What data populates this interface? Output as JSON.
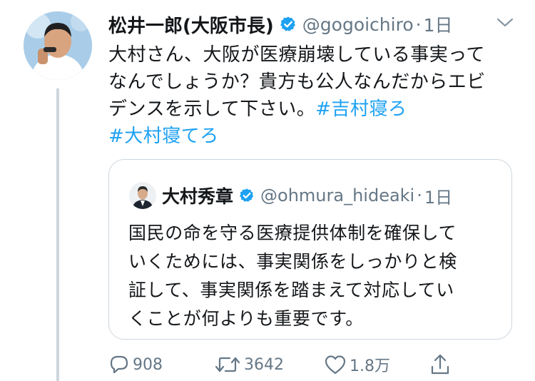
{
  "tweet": {
    "author_name": "松井一郎(大阪市長)",
    "handle": "@gogoichiro",
    "separator": "·",
    "time": "1日",
    "text_lines": [
      "大村さん、大阪が医療崩壊している事実って",
      "なんでしょうか？貴方も公人なんだからエビ"
    ],
    "text_line3": "デンスを示して下さい。",
    "hashtag1": "#吉村寝ろ",
    "hashtag2": "#大村寝てろ"
  },
  "quoted_tweet": {
    "author_name": "大村秀章",
    "handle": "@ohmura_hideaki",
    "separator": "·",
    "time": "1日",
    "text_lines": [
      "国民の命を守る医療提供体制を確保して",
      "いくためには、事実関係をしっかりと検",
      "証して、事実関係を踏まえて対応してい",
      "くことが何よりも重要です。"
    ]
  },
  "actions": {
    "reply_count": "908",
    "retweet_count": "3642",
    "like_count": "1.8万"
  },
  "colors": {
    "accent": "#1da1f2",
    "secondary_text": "#657786",
    "border": "#ccd6dd"
  },
  "icons": [
    "verified-badge-icon",
    "chevron-down-icon",
    "reply-icon",
    "retweet-icon",
    "like-icon",
    "share-icon"
  ]
}
